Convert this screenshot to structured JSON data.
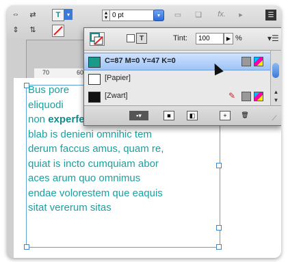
{
  "toolbar": {
    "stroke_weight_value": "0 pt",
    "fx_label": "fx."
  },
  "ruler": {
    "ticks": [
      "70",
      "60"
    ]
  },
  "swatches_panel": {
    "tint_label": "Tint:",
    "tint_value": "100",
    "tint_unit": "%",
    "rows": [
      {
        "label": "C=87 M=0 Y=47 K=0",
        "color": "#1a9a8a",
        "selected": true
      },
      {
        "label": "[Papier]",
        "color": "#ffffff",
        "selected": false
      },
      {
        "label": "[Zwart]",
        "color": "#111111",
        "selected": false
      }
    ]
  },
  "text_frame": {
    "lines": [
      "Bus pore",
      "eliquodi",
      "non experferias explaborio",
      "blab is denieni omnihic tem",
      "derum faccus amus, quam re,",
      "quiat is incto cumquiam abor",
      "aces arum quo omnimus",
      "endae volorestem que eaquis",
      "sitat vererum sitas"
    ],
    "bold_word": "experferias",
    "text_color": "#1aa0a0"
  },
  "colors": {
    "accent": "#2b6ad8",
    "selection": "#9fc3f6",
    "frame_edge": "#5ba0d8"
  }
}
